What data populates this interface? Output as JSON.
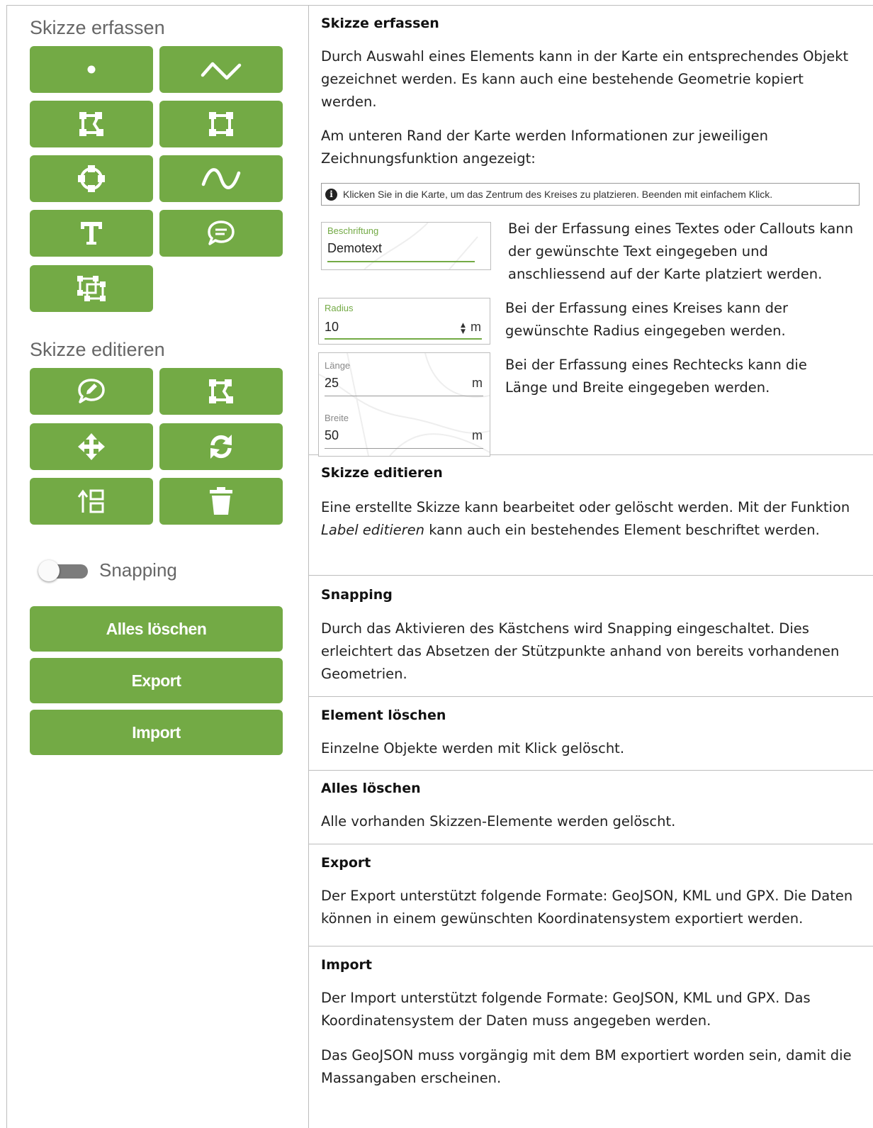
{
  "left_panel": {
    "sketch_create_title": "Skizze erfassen",
    "sketch_edit_title": "Skizze editieren",
    "snapping_label": "Snapping",
    "snapping_enabled": false,
    "delete_all_label": "Alles löschen",
    "export_label": "Export",
    "import_label": "Import",
    "accent_color": "#73aa45",
    "create_tools": [
      "point-icon",
      "polyline-icon",
      "polygon-icon",
      "rectangle-icon",
      "circle-icon",
      "freehand-icon",
      "text-icon",
      "callout-icon",
      "copy-geometry-icon"
    ],
    "edit_tools": [
      "edit-label-icon",
      "edit-vertices-icon",
      "move-icon",
      "rotate-icon",
      "order-icon",
      "trash-icon"
    ]
  },
  "sections": {
    "create": {
      "title": "Skizze erfassen",
      "p1": "Durch Auswahl eines Elements kann in der Karte ein entsprechendes Objekt gezeichnet werden. Es kann auch eine bestehende Geometrie kopiert werden.",
      "p2": "Am unteren Rand der Karte werden Informationen zur jeweiligen Zeichnungsfunktion angezeigt:",
      "infobar": "Klicken Sie in die Karte, um das Zentrum des Kreises zu platzieren. Beenden mit einfachem Klick.",
      "text_field": {
        "label": "Beschriftung",
        "value": "Demotext"
      },
      "text_desc": "Bei der Erfassung eines Textes oder Callouts kann der gewünschte Text eingegeben und anschliessend auf der Karte platziert werden.",
      "radius_field": {
        "label": "Radius",
        "value": "10",
        "unit": "m"
      },
      "radius_desc": "Bei der Erfassung eines Kreises kann der gewünschte Radius eingegeben werden.",
      "length_field": {
        "label": "Länge",
        "value": "25",
        "unit": "m"
      },
      "width_field": {
        "label": "Breite",
        "value": "50",
        "unit": "m"
      },
      "rect_desc": "Bei der Erfassung eines Rechtecks kann die Länge und Breite eingegeben werden."
    },
    "edit": {
      "title": "Skizze editieren",
      "p_before": "Eine erstellte Skizze kann bearbeitet oder gelöscht werden. Mit der Funktion ",
      "p_em": "Label editieren",
      "p_after": " kann auch ein bestehendes Element beschriftet werden."
    },
    "snapping": {
      "title": "Snapping",
      "p": "Durch das Aktivieren des Kästchens wird Snapping eingeschaltet. Dies erleichtert das Absetzen der Stützpunkte anhand von bereits vorhandenen Geometrien."
    },
    "delete_element": {
      "title": "Element löschen",
      "p": "Einzelne Objekte werden mit Klick gelöscht."
    },
    "delete_all": {
      "title": "Alles löschen",
      "p": "Alle vorhanden Skizzen-Elemente werden gelöscht."
    },
    "export": {
      "title": "Export",
      "p": "Der Export unterstützt folgende Formate: GeoJSON, KML und GPX. Die Daten können in einem gewünschten Koordinatensystem exportiert werden."
    },
    "import": {
      "title": "Import",
      "p1": "Der Import unterstützt folgende Formate: GeoJSON, KML und GPX. Das Koordinatensystem der Daten muss angegeben werden.",
      "p2": "Das GeoJSON muss vorgängig mit dem BM exportiert worden sein, damit die Massangaben erscheinen."
    }
  }
}
